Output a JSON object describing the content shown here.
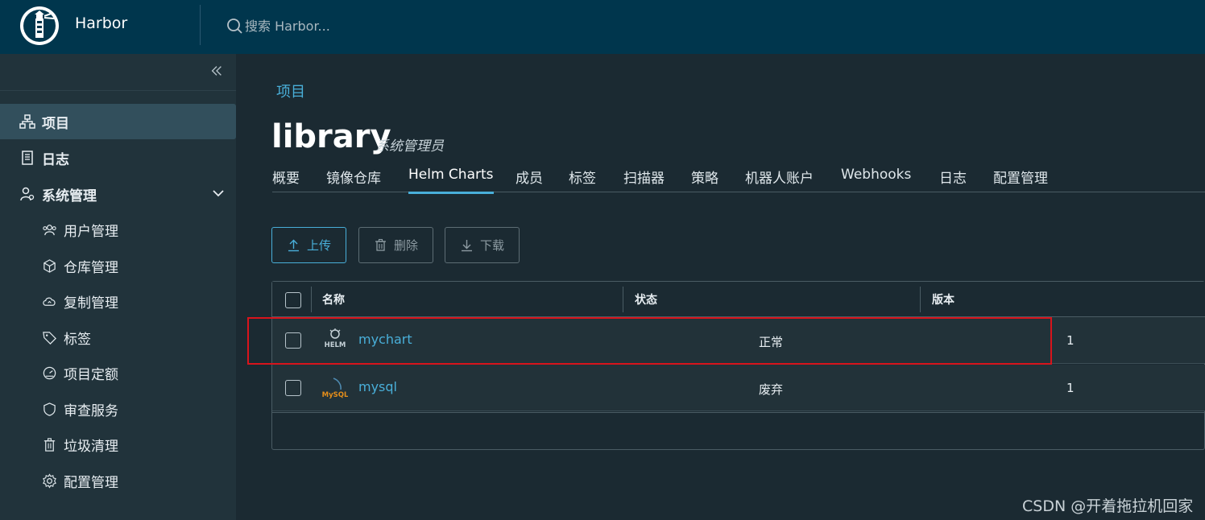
{
  "app": {
    "brand": "Harbor"
  },
  "search": {
    "placeholder": "搜索 Harbor..."
  },
  "sidebar": {
    "items": [
      {
        "label": "项目",
        "icon": "project-icon"
      },
      {
        "label": "日志",
        "icon": "log-icon"
      },
      {
        "label": "系统管理",
        "icon": "system-admin-icon"
      }
    ],
    "sub_items": [
      {
        "label": "用户管理",
        "icon": "users-icon"
      },
      {
        "label": "仓库管理",
        "icon": "registry-icon"
      },
      {
        "label": "复制管理",
        "icon": "replication-icon"
      },
      {
        "label": "标签",
        "icon": "tag-icon"
      },
      {
        "label": "项目定额",
        "icon": "quota-icon"
      },
      {
        "label": "审查服务",
        "icon": "shield-icon"
      },
      {
        "label": "垃圾清理",
        "icon": "trash-icon"
      },
      {
        "label": "配置管理",
        "icon": "gear-icon"
      }
    ]
  },
  "page": {
    "breadcrumb": "项目",
    "title": "library",
    "role": "系统管理员"
  },
  "tabs": [
    {
      "label": "概要"
    },
    {
      "label": "镜像仓库"
    },
    {
      "label": "Helm Charts",
      "active": true
    },
    {
      "label": "成员"
    },
    {
      "label": "标签"
    },
    {
      "label": "扫描器"
    },
    {
      "label": "策略"
    },
    {
      "label": "机器人账户"
    },
    {
      "label": "Webhooks"
    },
    {
      "label": "日志"
    },
    {
      "label": "配置管理"
    }
  ],
  "toolbar": {
    "upload_label": "上传",
    "delete_label": "删除",
    "download_label": "下载"
  },
  "table": {
    "columns": [
      "名称",
      "状态",
      "版本"
    ],
    "rows": [
      {
        "name": "mychart",
        "status": "正常",
        "version": "1",
        "icon": "helm-icon",
        "icon_text": "HELM"
      },
      {
        "name": "mysql",
        "status": "废弃",
        "version": "1",
        "icon": "mysql-icon",
        "icon_text": "MySQL"
      }
    ]
  },
  "watermark": "CSDN @开着拖拉机回家",
  "colors": {
    "header": "#00364d",
    "sidebar": "#21333b",
    "background": "#1b2a32",
    "accent": "#49afd9",
    "highlight": "#d8141c"
  }
}
